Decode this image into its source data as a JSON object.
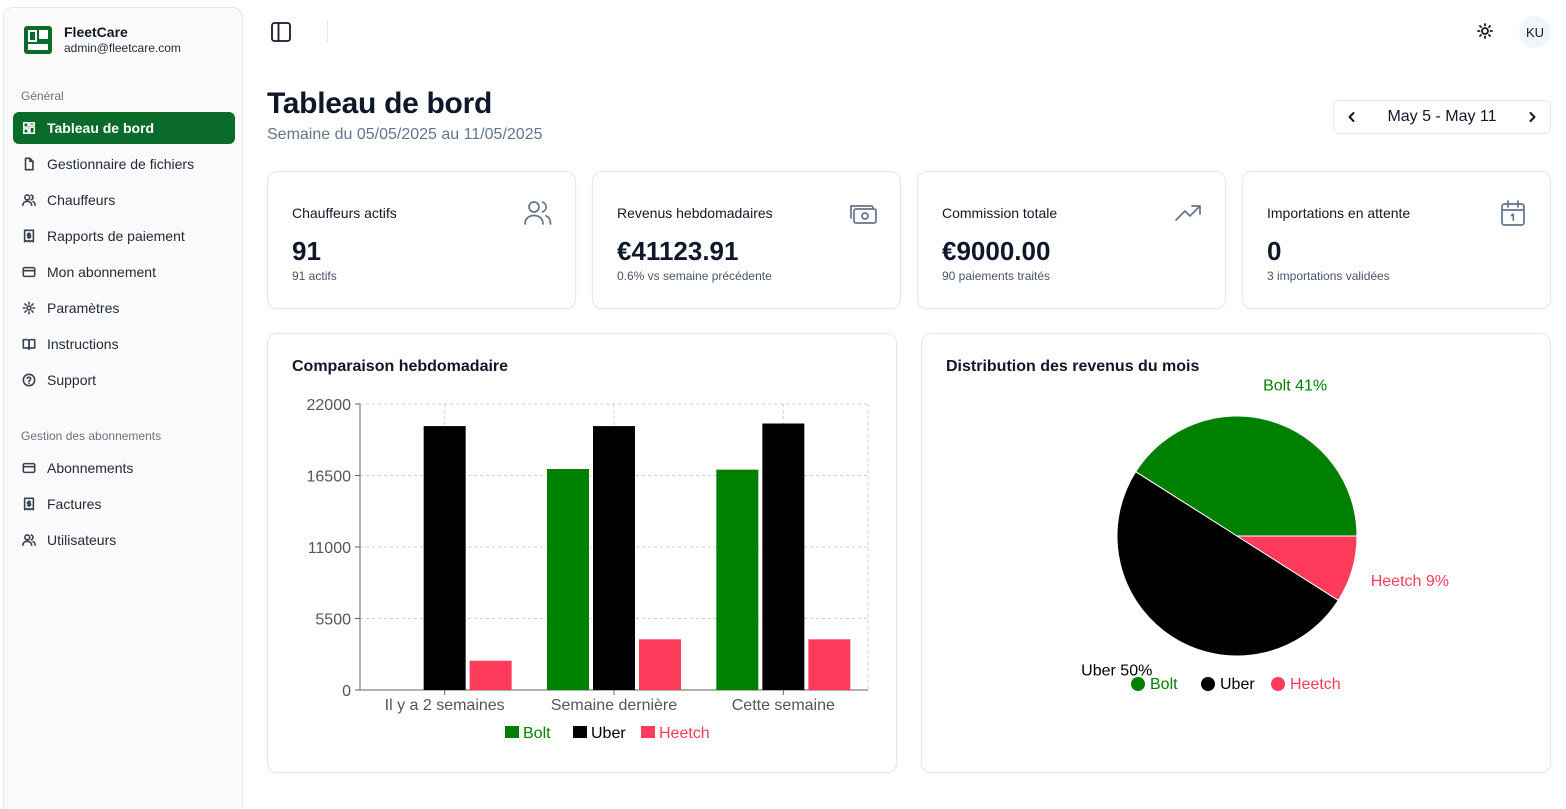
{
  "app": {
    "name": "FleetCare",
    "email": "admin@fleetcare.com"
  },
  "sidebar": {
    "groups": [
      {
        "label": "Général",
        "items": [
          {
            "label": "Tableau de bord",
            "icon": "dashboard-icon",
            "active": true
          },
          {
            "label": "Gestionnaire de fichiers",
            "icon": "file-icon"
          },
          {
            "label": "Chauffeurs",
            "icon": "users-icon"
          },
          {
            "label": "Rapports de paiement",
            "icon": "receipt-icon"
          },
          {
            "label": "Mon abonnement",
            "icon": "credit-card-icon"
          },
          {
            "label": "Paramètres",
            "icon": "gear-icon"
          },
          {
            "label": "Instructions",
            "icon": "book-icon"
          },
          {
            "label": "Support",
            "icon": "help-circle-icon"
          }
        ]
      },
      {
        "label": "Gestion des abonnements",
        "items": [
          {
            "label": "Abonnements",
            "icon": "credit-card-icon"
          },
          {
            "label": "Factures",
            "icon": "receipt-icon"
          },
          {
            "label": "Utilisateurs",
            "icon": "users-icon"
          }
        ]
      }
    ]
  },
  "topbar": {
    "toggle_icon": "sidebar-toggle-icon",
    "theme_icon": "sun-icon",
    "avatar_initials": "KU"
  },
  "header": {
    "title": "Tableau de bord",
    "subtitle": "Semaine du 05/05/2025 au 11/05/2025",
    "date_range": "May 5 - May 11"
  },
  "kpis": [
    {
      "title": "Chauffeurs actifs",
      "value": "91",
      "sub": "91 actifs",
      "icon": "users-icon"
    },
    {
      "title": "Revenus hebdomadaires",
      "value": "€41123.91",
      "sub": "0.6% vs semaine précédente",
      "icon": "cash-icon"
    },
    {
      "title": "Commission totale",
      "value": "€9000.00",
      "sub": "90 paiements traités",
      "icon": "trending-up-icon"
    },
    {
      "title": "Importations en attente",
      "value": "0",
      "sub": "3 importations validées",
      "icon": "calendar-icon"
    }
  ],
  "colors": {
    "brand": "#0b6b2b",
    "bolt": "#008000",
    "uber": "#000000",
    "heetch": "#ff3b5c"
  },
  "chart_data": [
    {
      "type": "bar",
      "title": "Comparaison hebdomadaire",
      "categories": [
        "Il y a 2 semaines",
        "Semaine dernière",
        "Cette semaine"
      ],
      "series": [
        {
          "name": "Bolt",
          "values": [
            0,
            17000,
            16950
          ]
        },
        {
          "name": "Uber",
          "values": [
            20300,
            20300,
            20500
          ]
        },
        {
          "name": "Heetch",
          "values": [
            2250,
            3900,
            3900
          ]
        }
      ],
      "yticks": [
        0,
        5500,
        11000,
        16500,
        22000
      ],
      "ylim": [
        0,
        22000
      ],
      "grid": true,
      "legend": "bottom"
    },
    {
      "type": "pie",
      "title": "Distribution des revenus du mois",
      "slices": [
        {
          "name": "Bolt",
          "value": 41,
          "label": "Bolt 41%"
        },
        {
          "name": "Uber",
          "value": 50,
          "label": "Uber 50%"
        },
        {
          "name": "Heetch",
          "value": 9,
          "label": "Heetch 9%"
        }
      ],
      "legend": "bottom"
    }
  ]
}
